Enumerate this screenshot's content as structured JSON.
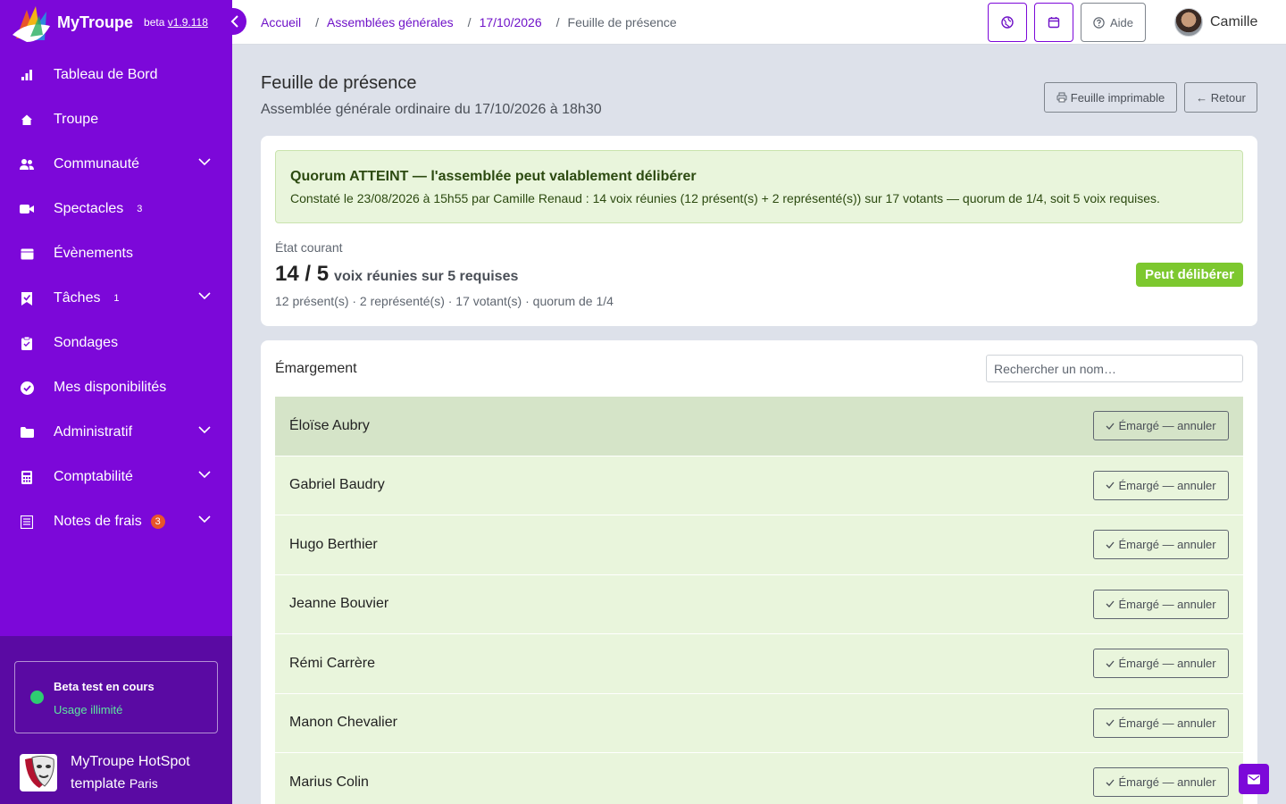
{
  "brand": {
    "name": "MyTroupe",
    "beta_label": "beta",
    "version": "v1.9.118"
  },
  "sidebar": {
    "items": [
      {
        "label": "Tableau de Bord",
        "icon": "bar-chart-icon"
      },
      {
        "label": "Troupe",
        "icon": "home-icon"
      },
      {
        "label": "Communauté",
        "icon": "users-icon",
        "expandable": true
      },
      {
        "label": "Spectacles",
        "icon": "video-camera-icon",
        "badge": "3"
      },
      {
        "label": "Évènements",
        "icon": "calendar-icon"
      },
      {
        "label": "Tâches",
        "icon": "bookmark-check-icon",
        "badge": "1",
        "expandable": true
      },
      {
        "label": "Sondages",
        "icon": "clipboard-icon"
      },
      {
        "label": "Mes disponibilités",
        "icon": "check-circle-icon"
      },
      {
        "label": "Administratif",
        "icon": "folder-icon",
        "expandable": true
      },
      {
        "label": "Comptabilité",
        "icon": "calculator-icon",
        "expandable": true
      },
      {
        "label": "Notes de frais",
        "icon": "receipt-icon",
        "badge": "3",
        "expandable": true
      }
    ],
    "beta": {
      "title": "Beta test en cours",
      "subtitle": "Usage illimité"
    },
    "troupe": {
      "name": "MyTroupe HotSpot",
      "name2": "template",
      "city": "Paris"
    }
  },
  "breadcrumb": {
    "items": [
      "Accueil",
      "Assemblées générales",
      "17/10/2026"
    ],
    "current": "Feuille de présence"
  },
  "topbar": {
    "help_label": "Aide",
    "user_name": "Camille"
  },
  "page": {
    "title": "Feuille de présence",
    "subtitle": "Assemblée générale ordinaire du 17/10/2026 à 18h30",
    "print_label": "Feuille imprimable",
    "back_label": "← Retour"
  },
  "quorum": {
    "alert_title": "Quorum ATTEINT — l'assemblée peut valablement délibérer",
    "alert_text": "Constaté le 23/08/2026 à 15h55 par Camille Renaud : 14 voix réunies (12 présent(s) + 2 représenté(s)) sur 17 votants — quorum de 1/4, soit 5 voix requises.",
    "state_label": "État courant",
    "count": "14 / 5",
    "count_suffix": "voix réunies sur 5 requises",
    "detail": "12 présent(s) · 2 représenté(s) · 17 votant(s) · quorum de 1/4",
    "status_badge": "Peut délibérer"
  },
  "signing": {
    "title": "Émargement",
    "search_placeholder": "Rechercher un nom…",
    "action_label": "Émargé — annuler",
    "rows": [
      "Éloïse Aubry",
      "Gabriel Baudry",
      "Hugo Berthier",
      "Jeanne Bouvier",
      "Rémi Carrère",
      "Manon Chevalier",
      "Marius Colin"
    ]
  },
  "colors": {
    "primary": "#7c08d9",
    "sidebar_bottom": "#5a0aa3",
    "success": "#7dc82f",
    "alert_bg": "#e9f5dc"
  }
}
